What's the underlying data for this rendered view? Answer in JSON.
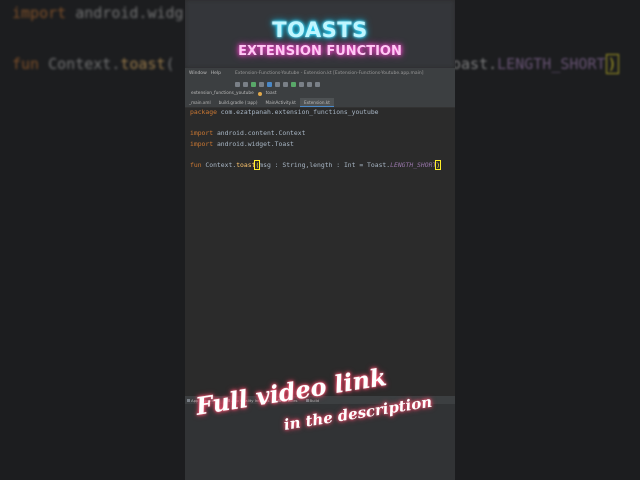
{
  "colors": {
    "keyword": "#cc7832",
    "function_name": "#ffc66d",
    "constant": "#9876aa",
    "default_text": "#a9b7c6",
    "editor_bg": "#2b2b2b",
    "title_glow": "#16d7ff",
    "subtitle_glow": "#ff2fc6",
    "cta_glow": "#ff3a62"
  },
  "overlay": {
    "title": "TOASTS",
    "subtitle": "EXTENSION FUNCTION",
    "cta_line1": "Full video link",
    "cta_line2": "in the description"
  },
  "background_code": {
    "line1_kw": "import",
    "line1_rest": " android.widg",
    "line2_kw": "fun",
    "line2_recv": " Context.",
    "line2_fn": "toast",
    "line2_paren": "(",
    "line2_tail_pre": "oast.",
    "line2_tail_const": "LENGTH_SHORT",
    "line2_tail_paren": ")"
  },
  "ide": {
    "menu": {
      "window": "Window",
      "help": "Help",
      "window_title": "Extension-Functions-Youtube - Extension.kt [Extension-Functions-Youtube.app.main]"
    },
    "breadcrumb": {
      "package": "extension_functions_youtube",
      "file": "toast"
    },
    "tabs": [
      {
        "label": "_main.xml",
        "active": false
      },
      {
        "label": "build.gradle (:app)",
        "active": false
      },
      {
        "label": "MainActivity.kt",
        "active": false
      },
      {
        "label": "Extension.kt",
        "active": true
      }
    ],
    "code": {
      "line1_kw": "package",
      "line1_rest": " com.ezatpanah.extension_functions_youtube",
      "line2_kw": "import",
      "line2_rest": " android.content.Context",
      "line3_kw": "import",
      "line3_rest": " android.widget.Toast",
      "line4_kw": "fun",
      "line4_recv": " Context.",
      "line4_fn": "toast",
      "line4_open": "(",
      "line4_params": "msg : String,length : Int = Toast.",
      "line4_const": "LENGTH_SHORT",
      "line4_close": ")"
    },
    "toolwindows": [
      {
        "label": "App Inspection",
        "icon": "inspection-icon"
      },
      {
        "label": "App Quality Insights",
        "icon": "quality-icon"
      },
      {
        "label": "Services",
        "icon": "services-icon"
      },
      {
        "label": "Build",
        "icon": "build-icon"
      }
    ]
  }
}
